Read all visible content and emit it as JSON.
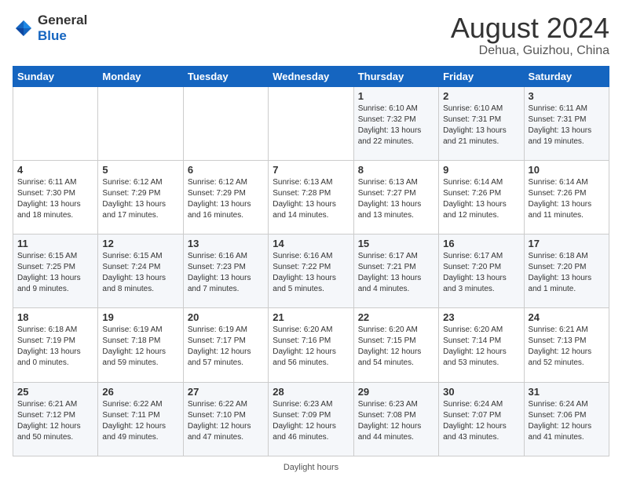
{
  "header": {
    "logo": {
      "general": "General",
      "blue": "Blue"
    },
    "title": "August 2024",
    "location": "Dehua, Guizhou, China"
  },
  "days_of_week": [
    "Sunday",
    "Monday",
    "Tuesday",
    "Wednesday",
    "Thursday",
    "Friday",
    "Saturday"
  ],
  "weeks": [
    [
      {
        "day": "",
        "info": ""
      },
      {
        "day": "",
        "info": ""
      },
      {
        "day": "",
        "info": ""
      },
      {
        "day": "",
        "info": ""
      },
      {
        "day": "1",
        "sunrise": "6:10 AM",
        "sunset": "7:32 PM",
        "daylight": "13 hours and 22 minutes."
      },
      {
        "day": "2",
        "sunrise": "6:10 AM",
        "sunset": "7:31 PM",
        "daylight": "13 hours and 21 minutes."
      },
      {
        "day": "3",
        "sunrise": "6:11 AM",
        "sunset": "7:31 PM",
        "daylight": "13 hours and 19 minutes."
      }
    ],
    [
      {
        "day": "4",
        "sunrise": "6:11 AM",
        "sunset": "7:30 PM",
        "daylight": "13 hours and 18 minutes."
      },
      {
        "day": "5",
        "sunrise": "6:12 AM",
        "sunset": "7:29 PM",
        "daylight": "13 hours and 17 minutes."
      },
      {
        "day": "6",
        "sunrise": "6:12 AM",
        "sunset": "7:29 PM",
        "daylight": "13 hours and 16 minutes."
      },
      {
        "day": "7",
        "sunrise": "6:13 AM",
        "sunset": "7:28 PM",
        "daylight": "13 hours and 14 minutes."
      },
      {
        "day": "8",
        "sunrise": "6:13 AM",
        "sunset": "7:27 PM",
        "daylight": "13 hours and 13 minutes."
      },
      {
        "day": "9",
        "sunrise": "6:14 AM",
        "sunset": "7:26 PM",
        "daylight": "13 hours and 12 minutes."
      },
      {
        "day": "10",
        "sunrise": "6:14 AM",
        "sunset": "7:26 PM",
        "daylight": "13 hours and 11 minutes."
      }
    ],
    [
      {
        "day": "11",
        "sunrise": "6:15 AM",
        "sunset": "7:25 PM",
        "daylight": "13 hours and 9 minutes."
      },
      {
        "day": "12",
        "sunrise": "6:15 AM",
        "sunset": "7:24 PM",
        "daylight": "13 hours and 8 minutes."
      },
      {
        "day": "13",
        "sunrise": "6:16 AM",
        "sunset": "7:23 PM",
        "daylight": "13 hours and 7 minutes."
      },
      {
        "day": "14",
        "sunrise": "6:16 AM",
        "sunset": "7:22 PM",
        "daylight": "13 hours and 5 minutes."
      },
      {
        "day": "15",
        "sunrise": "6:17 AM",
        "sunset": "7:21 PM",
        "daylight": "13 hours and 4 minutes."
      },
      {
        "day": "16",
        "sunrise": "6:17 AM",
        "sunset": "7:20 PM",
        "daylight": "13 hours and 3 minutes."
      },
      {
        "day": "17",
        "sunrise": "6:18 AM",
        "sunset": "7:20 PM",
        "daylight": "13 hours and 1 minute."
      }
    ],
    [
      {
        "day": "18",
        "sunrise": "6:18 AM",
        "sunset": "7:19 PM",
        "daylight": "13 hours and 0 minutes."
      },
      {
        "day": "19",
        "sunrise": "6:19 AM",
        "sunset": "7:18 PM",
        "daylight": "12 hours and 59 minutes."
      },
      {
        "day": "20",
        "sunrise": "6:19 AM",
        "sunset": "7:17 PM",
        "daylight": "12 hours and 57 minutes."
      },
      {
        "day": "21",
        "sunrise": "6:20 AM",
        "sunset": "7:16 PM",
        "daylight": "12 hours and 56 minutes."
      },
      {
        "day": "22",
        "sunrise": "6:20 AM",
        "sunset": "7:15 PM",
        "daylight": "12 hours and 54 minutes."
      },
      {
        "day": "23",
        "sunrise": "6:20 AM",
        "sunset": "7:14 PM",
        "daylight": "12 hours and 53 minutes."
      },
      {
        "day": "24",
        "sunrise": "6:21 AM",
        "sunset": "7:13 PM",
        "daylight": "12 hours and 52 minutes."
      }
    ],
    [
      {
        "day": "25",
        "sunrise": "6:21 AM",
        "sunset": "7:12 PM",
        "daylight": "12 hours and 50 minutes."
      },
      {
        "day": "26",
        "sunrise": "6:22 AM",
        "sunset": "7:11 PM",
        "daylight": "12 hours and 49 minutes."
      },
      {
        "day": "27",
        "sunrise": "6:22 AM",
        "sunset": "7:10 PM",
        "daylight": "12 hours and 47 minutes."
      },
      {
        "day": "28",
        "sunrise": "6:23 AM",
        "sunset": "7:09 PM",
        "daylight": "12 hours and 46 minutes."
      },
      {
        "day": "29",
        "sunrise": "6:23 AM",
        "sunset": "7:08 PM",
        "daylight": "12 hours and 44 minutes."
      },
      {
        "day": "30",
        "sunrise": "6:24 AM",
        "sunset": "7:07 PM",
        "daylight": "12 hours and 43 minutes."
      },
      {
        "day": "31",
        "sunrise": "6:24 AM",
        "sunset": "7:06 PM",
        "daylight": "12 hours and 41 minutes."
      }
    ]
  ],
  "footer": {
    "daylight_label": "Daylight hours"
  },
  "colors": {
    "header_bg": "#1565c0",
    "header_text": "#ffffff",
    "odd_row": "#f5f7fa",
    "even_row": "#ffffff"
  }
}
